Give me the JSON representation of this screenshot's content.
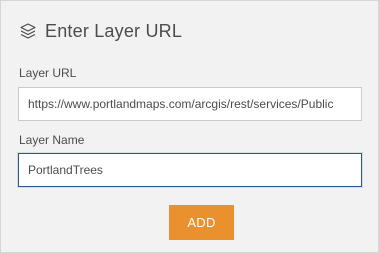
{
  "header": {
    "icon": "layers-icon",
    "title": "Enter Layer URL"
  },
  "form": {
    "url_label": "Layer URL",
    "url_value": "https://www.portlandmaps.com/arcgis/rest/services/Public",
    "name_label": "Layer Name",
    "name_value": "PortlandTrees",
    "add_label": "ADD"
  },
  "colors": {
    "panel_bg": "#f2f2f2",
    "add_button": "#e8912e",
    "focus_border": "#2f5b8c",
    "text": "#4c4c4c"
  }
}
